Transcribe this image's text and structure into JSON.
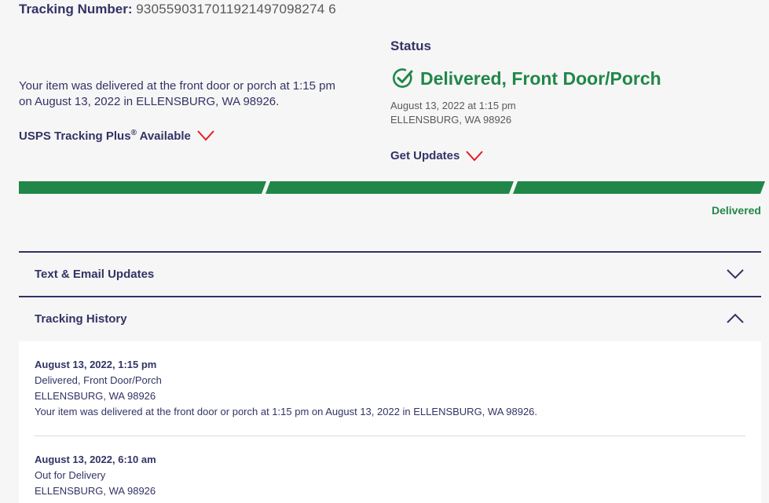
{
  "tracking": {
    "label": "Tracking Number:",
    "number": "9305590317011921497098274 6"
  },
  "summary": {
    "text": "Your item was delivered at the front door or porch at 1:15 pm on August 13, 2022 in ELLENSBURG, WA 98926.",
    "plus_label": "USPS Tracking Plus",
    "plus_reg": "®",
    "plus_suffix": "Available"
  },
  "status": {
    "heading": "Status",
    "main": "Delivered, Front Door/Porch",
    "date": "August 13, 2022 at 1:15 pm",
    "location": "ELLENSBURG, WA 98926",
    "get_updates": "Get Updates"
  },
  "progress": {
    "label": "Delivered",
    "segments_complete": 3,
    "segments_total": 3
  },
  "sections": {
    "text_email": "Text & Email Updates",
    "history": "Tracking History"
  },
  "history": [
    {
      "time": "August 13, 2022, 1:15 pm",
      "status": "Delivered, Front Door/Porch",
      "location": "ELLENSBURG, WA 98926",
      "detail": "Your item was delivered at the front door or porch at 1:15 pm on August 13, 2022 in ELLENSBURG, WA 98926."
    },
    {
      "time": "August 13, 2022, 6:10 am",
      "status": "Out for Delivery",
      "location": "ELLENSBURG, WA 98926"
    }
  ],
  "colors": {
    "navy": "#333366",
    "green": "#218748",
    "red": "#e71921"
  }
}
